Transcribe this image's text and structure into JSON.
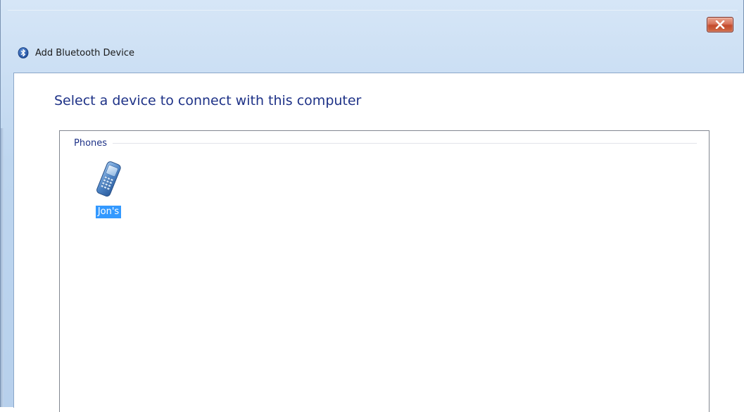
{
  "window": {
    "title": "Add Bluetooth Device",
    "close_label": "Close"
  },
  "content": {
    "heading": "Select a device to connect with this computer"
  },
  "device_list": {
    "groups": [
      {
        "label": "Phones",
        "devices": [
          {
            "name": "Jon's",
            "icon": "mobile-phone-icon",
            "selected": true
          }
        ]
      }
    ]
  },
  "colors": {
    "heading": "#1e3287",
    "selection": "#3399ff",
    "frame": "#bed6ef",
    "close_button": "#c34a2c"
  }
}
